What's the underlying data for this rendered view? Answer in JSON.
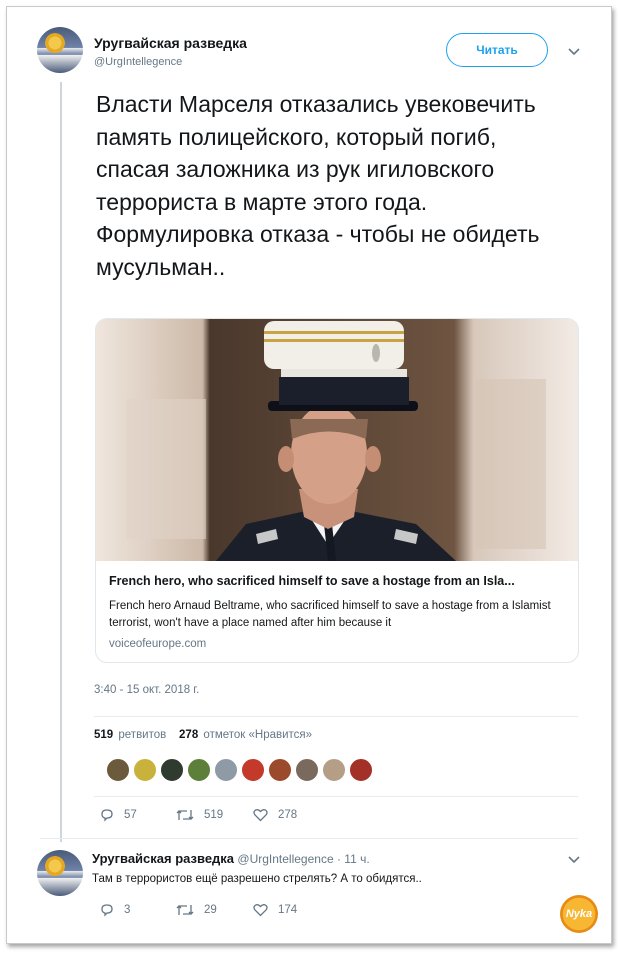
{
  "tweet": {
    "author_name": "Уругвайская разведка",
    "author_handle": "@UrgIntellegence",
    "follow_label": "Читать",
    "text_lines": [
      "Власти Марселя отказались увековечить память полицейского, который погиб, спасая заложника из рук игиловского террориста в марте этого года.",
      "Формулировка отказа - чтобы не обидеть мусульман.."
    ],
    "card": {
      "title": "French hero, who sacrificed himself to save a hostage from an Isla...",
      "description": "French hero Arnaud Beltrame, who sacrificed himself to save a hostage from a Islamist terrorist, won't have a place named after him because it",
      "domain": "voiceofeurope.com"
    },
    "timestamp": "3:40 - 15 окт. 2018 г.",
    "stats": {
      "retweets_count": "519",
      "retweets_label": "ретвитов",
      "likes_count": "278",
      "likes_label": "отметок «Нравится»"
    },
    "actions": {
      "replies": "57",
      "retweets": "519",
      "likes": "278"
    }
  },
  "reply": {
    "author_name": "Уругвайская разведка",
    "handle_time": "@UrgIntellegence · 11 ч.",
    "text": "Там в террористов ещё разрешено стрелять? А то обидятся..",
    "actions": {
      "replies": "3",
      "retweets": "29",
      "likes": "174"
    }
  },
  "watermark": "Nyka",
  "colors": {
    "accent": "#1da1f2",
    "secondary_text": "#657786",
    "border": "#e1e8ed"
  }
}
